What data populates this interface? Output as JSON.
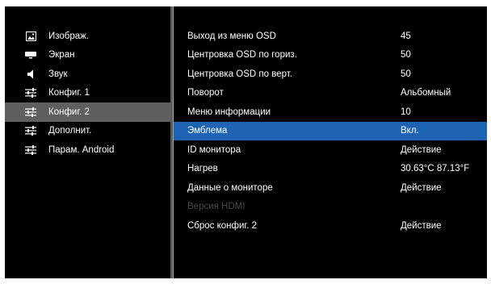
{
  "sidebar": {
    "items": [
      {
        "label": "Изображ.",
        "icon": "picture-icon",
        "selected": false
      },
      {
        "label": "Экран",
        "icon": "screen-icon",
        "selected": false
      },
      {
        "label": "Звук",
        "icon": "speaker-icon",
        "selected": false
      },
      {
        "label": "Конфиг. 1",
        "icon": "sliders-icon",
        "selected": false
      },
      {
        "label": "Конфиг. 2",
        "icon": "sliders-icon",
        "selected": true
      },
      {
        "label": "Дополнит.",
        "icon": "sliders-icon",
        "selected": false
      },
      {
        "label": "Парам. Android",
        "icon": "sliders-icon",
        "selected": false
      }
    ]
  },
  "settings": {
    "rows": [
      {
        "label": "Выход из меню OSD",
        "value": "45"
      },
      {
        "label": "Центровка OSD по гориз.",
        "value": "50"
      },
      {
        "label": "Центровка OSD по верт.",
        "value": "50"
      },
      {
        "label": "Поворот",
        "value": "Альбомный"
      },
      {
        "label": "Меню информации",
        "value": "10"
      },
      {
        "label": "Эмблема",
        "value": "Вкл.",
        "selected": true
      },
      {
        "label": "ID монитора",
        "value": "Действие"
      },
      {
        "label": "Нагрев",
        "value": "30.63°C 87.13°F"
      },
      {
        "label": "Данные о мониторе",
        "value": "Действие"
      },
      {
        "label": "Версия HDMI",
        "value": "",
        "disabled": true
      },
      {
        "label": "Сброс конфиг. 2",
        "value": "Действие"
      }
    ]
  },
  "colors": {
    "selected_row": "#1e63b4",
    "selected_side": "#5f5f5f",
    "disabled_text": "#4a4a4a"
  }
}
